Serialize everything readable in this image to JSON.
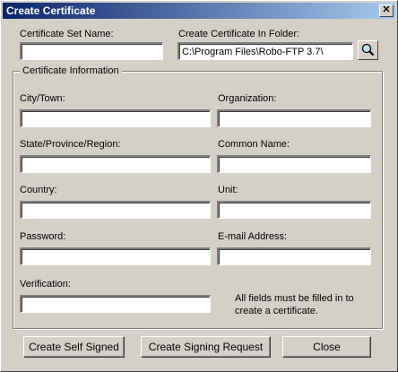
{
  "window": {
    "title": "Create Certificate",
    "close_glyph": "✕"
  },
  "top": {
    "set_name_label": "Certificate Set Name:",
    "set_name_value": "",
    "folder_label": "Create Certificate In Folder:",
    "folder_value": "C:\\Program Files\\Robo-FTP 3.7\\",
    "browse_icon": "magnifier-icon"
  },
  "group": {
    "legend": "Certificate Information",
    "fields": {
      "city": {
        "label": "City/Town:",
        "value": ""
      },
      "organization": {
        "label": "Organization:",
        "value": ""
      },
      "state": {
        "label": "State/Province/Region:",
        "value": ""
      },
      "common_name": {
        "label": "Common Name:",
        "value": ""
      },
      "country": {
        "label": "Country:",
        "value": ""
      },
      "unit": {
        "label": "Unit:",
        "value": ""
      },
      "password": {
        "label": "Password:",
        "value": ""
      },
      "email": {
        "label": "E-mail Address:",
        "value": ""
      },
      "verification": {
        "label": "Verification:",
        "value": ""
      }
    },
    "note_line1": "All fields must be filled in to",
    "note_line2": "create a certificate."
  },
  "buttons": {
    "self_signed": "Create Self Signed",
    "signing_request": "Create Signing Request",
    "close": "Close"
  }
}
